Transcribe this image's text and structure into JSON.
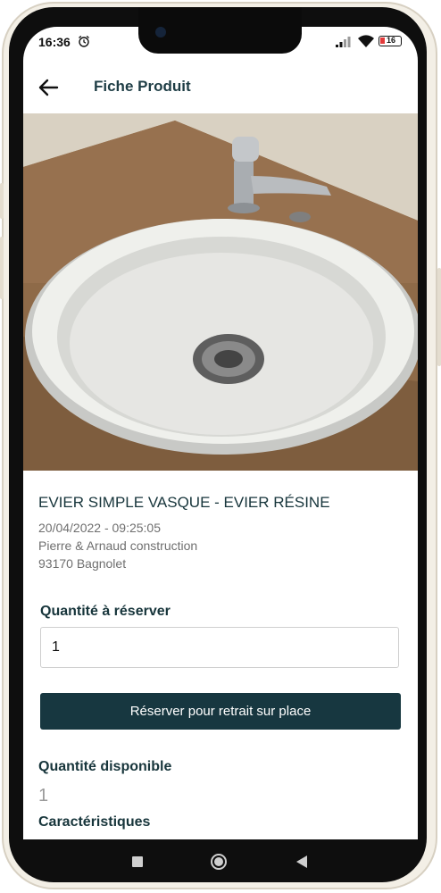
{
  "status_bar": {
    "time": "16:36",
    "battery": "16"
  },
  "app_bar": {
    "title": "Fiche Produit"
  },
  "product": {
    "name": "EVIER SIMPLE VASQUE - EVIER RÉSINE",
    "date": "20/04/2022 - 09:25:05",
    "seller": "Pierre & Arnaud construction",
    "location": "93170 Bagnolet"
  },
  "reserve": {
    "quantity_label": "Quantité à réserver",
    "quantity_value": "1",
    "button_label": "Réserver pour retrait sur place"
  },
  "availability": {
    "label": "Quantité disponible",
    "value": "1"
  },
  "characteristics": {
    "label": "Caractéristiques"
  },
  "colors": {
    "primary": "#173740",
    "text": "#17353b",
    "muted": "#6f6f6f"
  }
}
